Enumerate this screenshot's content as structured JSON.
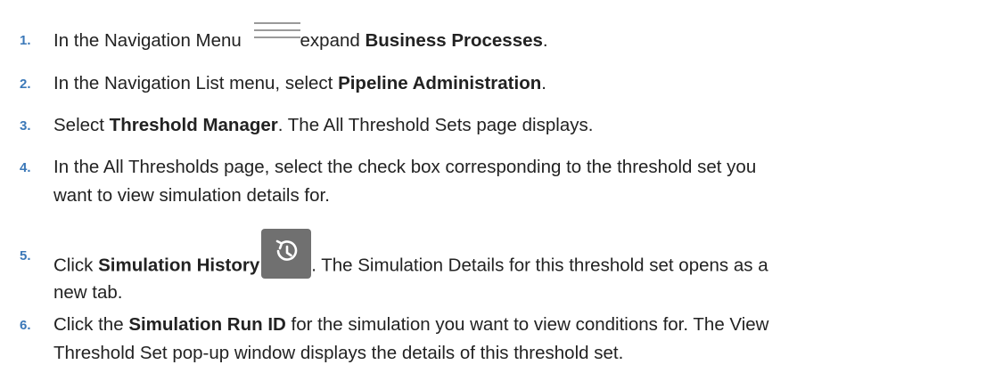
{
  "steps": [
    {
      "number": "1.",
      "parts": [
        "In the Navigation Menu ",
        "expand ",
        "Business Processes",
        "."
      ]
    },
    {
      "number": "2.",
      "parts": [
        "In the Navigation List menu, select ",
        "Pipeline Administration",
        "."
      ]
    },
    {
      "number": "3.",
      "parts": [
        "Select ",
        "Threshold Manager",
        ". The All Threshold Sets page displays."
      ]
    },
    {
      "number": "4.",
      "lines": [
        "In the All Thresholds page, select the check box corresponding to the threshold set you",
        "want to view simulation details for."
      ]
    },
    {
      "number": "5.",
      "parts": [
        "Click ",
        "Simulation History",
        ". The Simulation Details for this threshold set opens as a"
      ],
      "line2": "new tab."
    },
    {
      "number": "6.",
      "parts": [
        "Click the ",
        "Simulation Run ID",
        " for the simulation you want to view conditions for. The View"
      ],
      "line2": "Threshold Set pop-up window displays the details of this threshold set."
    }
  ],
  "icons": {
    "navigation_menu": "hamburger-menu-icon",
    "simulation_history": "history-icon"
  },
  "colors": {
    "step_number": "#3b78b8",
    "history_button_bg": "#707070"
  }
}
